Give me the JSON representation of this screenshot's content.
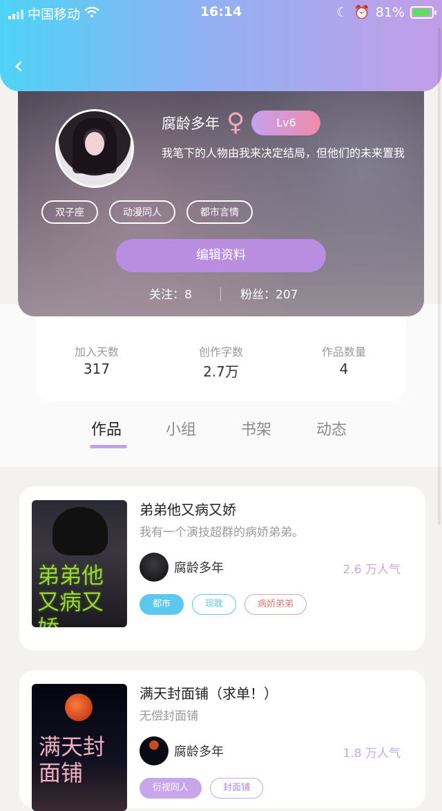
{
  "status_bar": {
    "carrier": "中国移动",
    "time": "16:14",
    "battery": "81%"
  },
  "profile": {
    "name": "腐龄多年",
    "gender_symbol": "♀",
    "level": "Lv6",
    "bio": "我笔下的人物由我来决定结局，但他们的未来置我",
    "tags": [
      "双子座",
      "动漫同人",
      "都市言情"
    ],
    "edit_label": "编辑资料",
    "following": "关注：8",
    "followers": "粉丝：207"
  },
  "stats": [
    {
      "label": "加入天数",
      "value": "317"
    },
    {
      "label": "创作字数",
      "value": "2.7万"
    },
    {
      "label": "作品数量",
      "value": "4"
    }
  ],
  "tabs": [
    "作品",
    "小组",
    "书架",
    "动态"
  ],
  "works": [
    {
      "title": "弟弟他又病又娇",
      "desc": "我有一个演技超群的病娇弟弟。",
      "author": "腐龄多年",
      "popularity": "2.6 万人气",
      "cover_title": "弟弟他又病又娇",
      "tags": [
        "都市",
        "现耽",
        "病娇弟弟"
      ]
    },
    {
      "title": "满天封面铺（求单！）",
      "desc": "无偿封面铺",
      "author": "腐龄多年",
      "popularity": "1.8 万人气",
      "cover_title": "满天封面铺",
      "tags": [
        "衍视同人",
        "封面铺"
      ]
    }
  ],
  "icons": {
    "back": "chevron-left-icon",
    "wifi": "wifi-icon",
    "moon": "moon-icon",
    "alarm": "alarm-icon",
    "battery": "battery-icon"
  },
  "colors": {
    "header_gradient_start": "#4fd3f7",
    "header_gradient_end": "#c49de8",
    "accent_purple": "#b98de0",
    "tag_blue": "#5cc8f0",
    "tag_red": "#e07a7a"
  }
}
